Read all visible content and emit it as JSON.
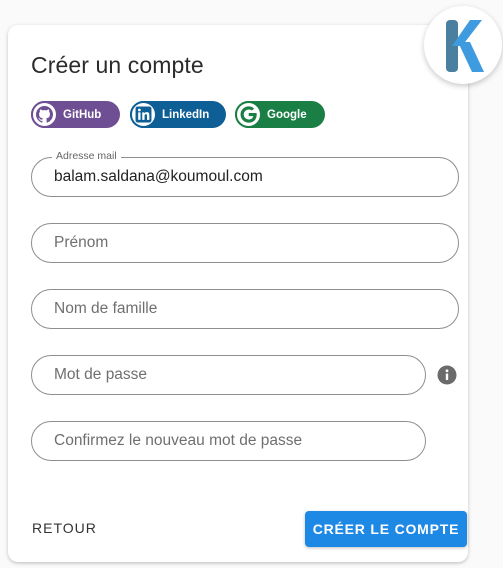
{
  "form": {
    "title": "Créer un compte",
    "social": {
      "github": {
        "label": "GitHub",
        "icon": "github-icon",
        "color": "#6e4f93"
      },
      "linkedin": {
        "label": "LinkedIn",
        "icon": "linkedin-icon",
        "color": "#0f5f97"
      },
      "google": {
        "label": "Google",
        "icon": "google-icon",
        "color": "#1a7f45"
      }
    },
    "fields": {
      "email": {
        "label": "Adresse mail",
        "value": "balam.saldana@koumoul.com"
      },
      "prenom": {
        "placeholder": "Prénom"
      },
      "nom": {
        "placeholder": "Nom de famille"
      },
      "password": {
        "placeholder": "Mot de passe"
      },
      "confirm": {
        "placeholder": "Confirmez le nouveau mot de passe"
      }
    },
    "password_info_icon": "info-icon",
    "back_label": "RETOUR",
    "submit_label": "CRÉER LE COMPTE",
    "accent_color": "#1e88e5",
    "logo_icon": "koumoul-k-logo"
  }
}
